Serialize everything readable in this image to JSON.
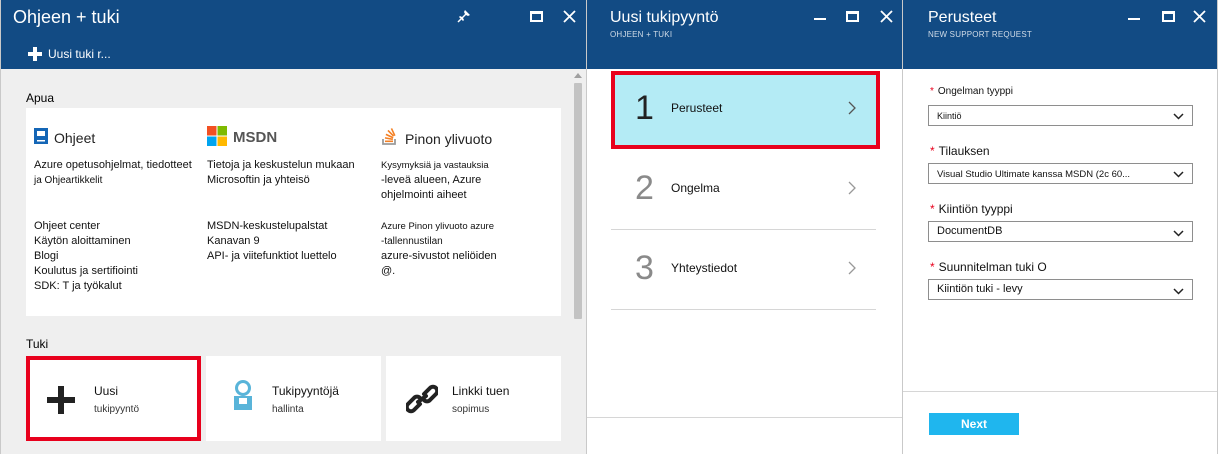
{
  "blade1": {
    "title": "Ohjeen + tuki",
    "new_button_label": "Uusi tuki r...",
    "help_section_label": "Apua",
    "help_columns": [
      {
        "heading": "Ohjeet",
        "icon": "book-icon",
        "desc_lines": [
          "Azure opetusohjelmat, tiedotteet",
          "ja Ohjeartikkelit"
        ],
        "links": [
          "Ohjeet center",
          "Käytön aloittaminen",
          "Blogi",
          "Koulutus ja sertifiointi",
          "SDK: T ja työkalut"
        ]
      },
      {
        "heading": "MSDN",
        "icon": "msdn-logo-icon",
        "desc_lines": [
          "Tietoja ja keskustelun mukaan",
          "Microsoftin ja yhteisö"
        ],
        "links": [
          "MSDN-keskustelupalstat",
          "Kanavan 9",
          "API- ja viitefunktiot luettelo"
        ]
      },
      {
        "heading": "Pinon ylivuoto",
        "icon": "stackoverflow-icon",
        "desc_lines": [
          "Kysymyksiä ja vastauksia",
          "-leveä alueen, Azure",
          "ohjelmointi aiheet"
        ],
        "links": [
          "Azure Pinon ylivuoto azure",
          "-tallennustilan",
          "azure-sivustot neliöiden",
          "@."
        ]
      }
    ],
    "support_section_label": "Tuki",
    "support_tiles": [
      {
        "title": "Uusi",
        "subtitle": "tukipyyntö",
        "icon": "plus-icon"
      },
      {
        "title": "Tukipyyntöjä",
        "subtitle": "hallinta",
        "icon": "person-icon"
      },
      {
        "title": "Linkki tuen",
        "subtitle": "sopimus",
        "icon": "link-icon"
      }
    ]
  },
  "blade2": {
    "title": "Uusi tukipyyntö",
    "subtitle": "OHJEEN + TUKI",
    "steps": [
      {
        "number": "1",
        "label": "Perusteet",
        "active": true
      },
      {
        "number": "2",
        "label": "Ongelma",
        "active": false
      },
      {
        "number": "3",
        "label": "Yhteystiedot",
        "active": false
      }
    ]
  },
  "blade3": {
    "title": "Perusteet",
    "subtitle": "NEW SUPPORT REQUEST",
    "fields": [
      {
        "label": "Ongelman tyyppi",
        "value": "Kiintiö"
      },
      {
        "label": "Tilauksen",
        "value": "Visual Studio Ultimate kanssa MSDN (2c 60..."
      },
      {
        "label": "Kiintiön tyyppi",
        "value": "DocumentDB"
      },
      {
        "label": "Suunnitelman tuki O",
        "value": "Kiintiön tuki - levy"
      }
    ],
    "next_label": "Next"
  },
  "colors": {
    "header_bg": "#124b84",
    "active_step_bg": "#b4ebf5",
    "highlight_red": "#e8001c",
    "next_button_bg": "#1fb6ee"
  }
}
